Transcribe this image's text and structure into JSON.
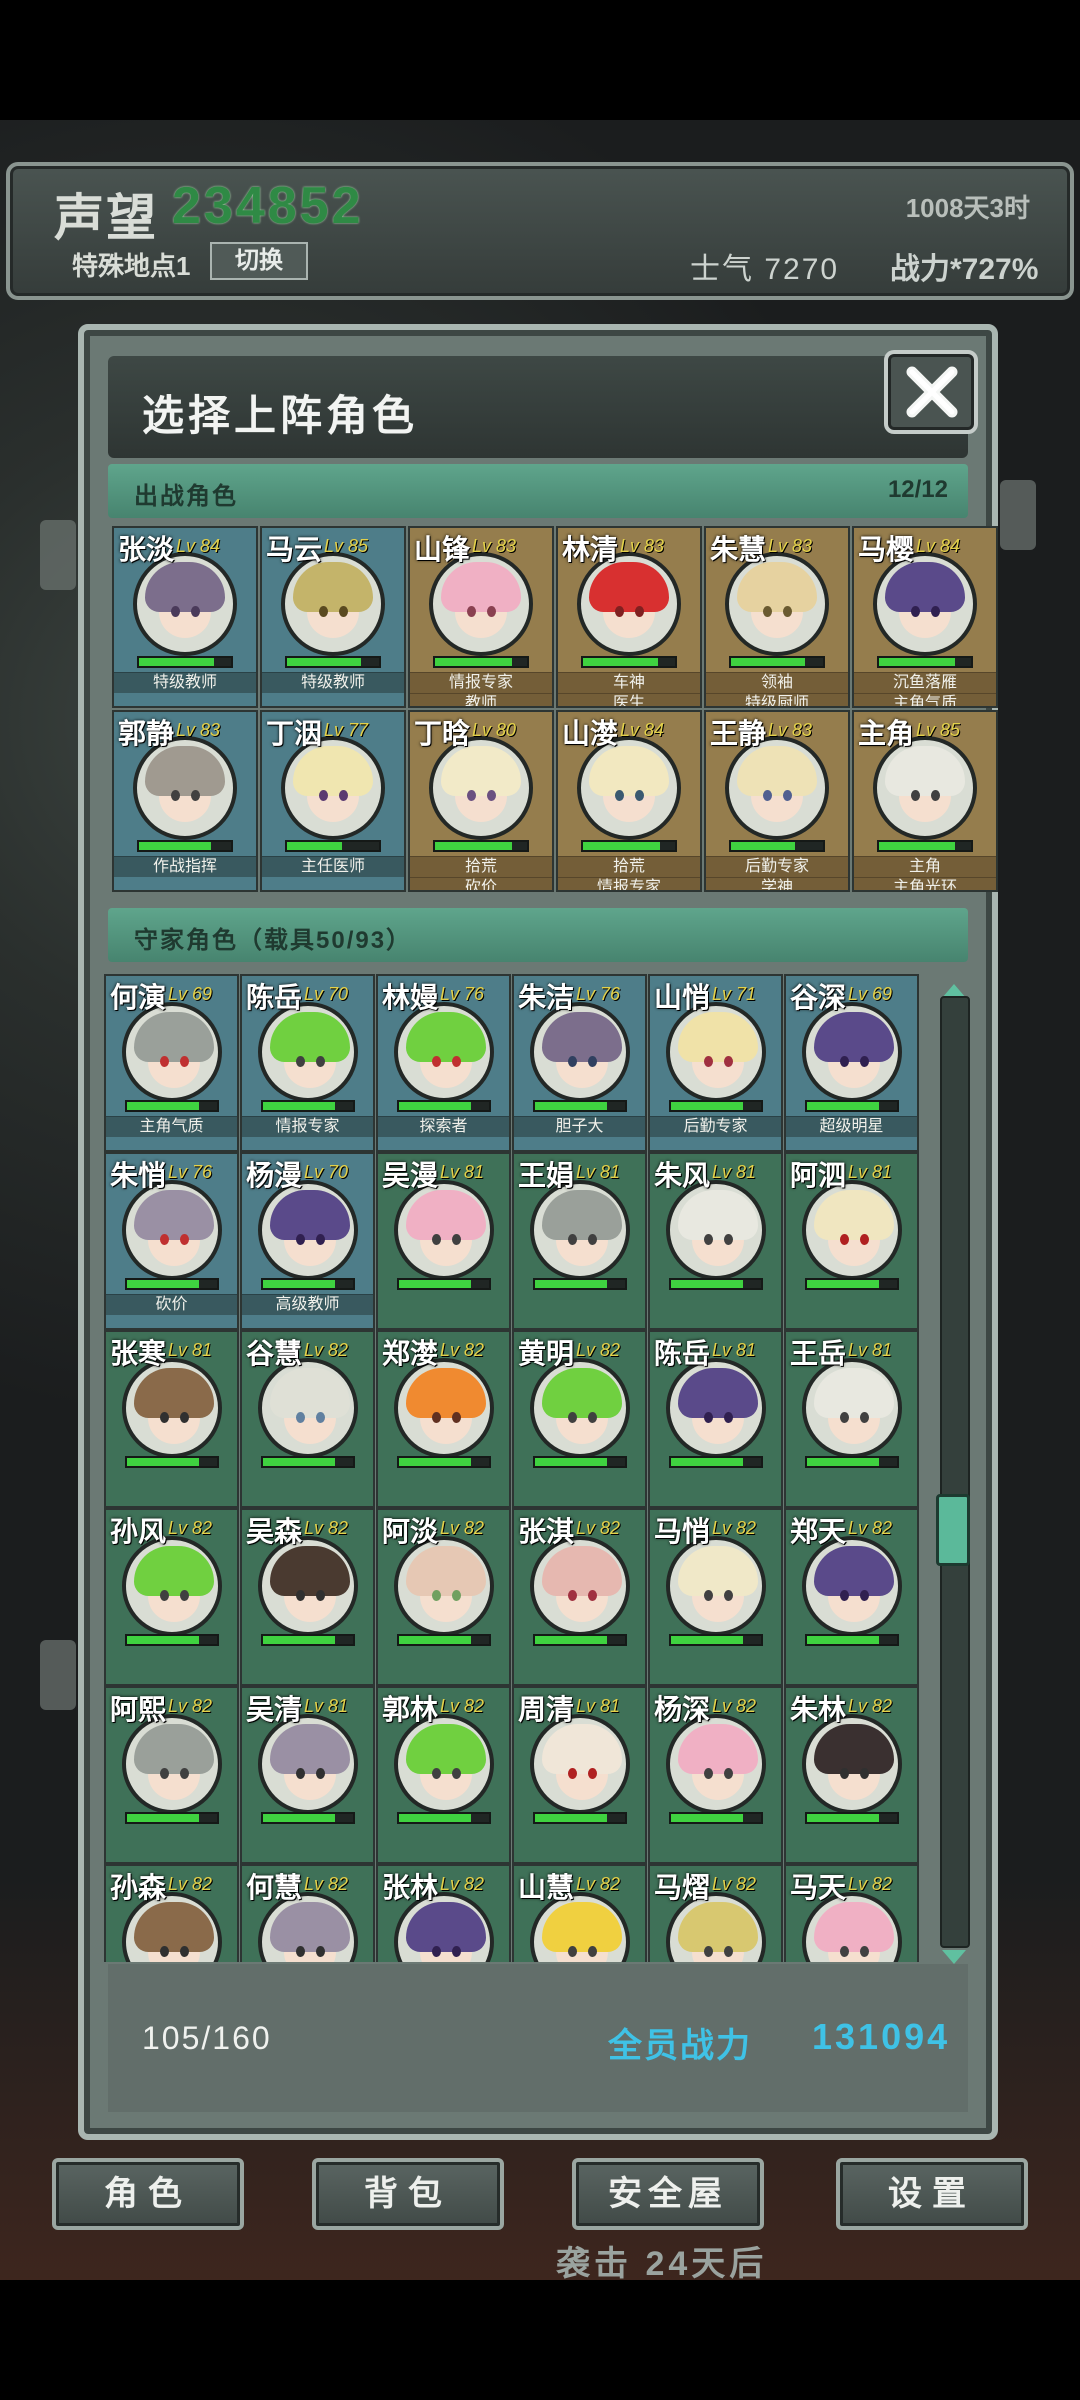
{
  "hud": {
    "reputation_label": "声望",
    "reputation_value": "234852",
    "days": "1008天3时",
    "special_location": "特殊地点1",
    "switch_label": "切换",
    "morale": "士气 7270",
    "combat_power": "战力*727%"
  },
  "modal": {
    "title": "选择上阵角色",
    "deployed_section": {
      "title": "出战角色",
      "count": "12/12"
    },
    "reserve_section": {
      "title": "守家角色（载具50/93）"
    },
    "deployed": [
      {
        "name": "张淡",
        "level": "Lv 84",
        "tags": [
          "特级教师"
        ],
        "style": "blue",
        "hair": "#7c6e8c",
        "eye": "#4a3a5a",
        "hp": 0.82
      },
      {
        "name": "马云",
        "level": "Lv 85",
        "tags": [
          "特级教师"
        ],
        "style": "blue",
        "hair": "#c4b46a",
        "eye": "#5a4a20",
        "hp": 0.8
      },
      {
        "name": "山锋",
        "level": "Lv 83",
        "tags": [
          "情报专家",
          "教师"
        ],
        "style": "gold",
        "hair": "#f0b0c4",
        "eye": "#8a4050",
        "hp": 0.84
      },
      {
        "name": "林清",
        "level": "Lv 83",
        "tags": [
          "车神",
          "医生"
        ],
        "style": "gold",
        "hair": "#d83030",
        "eye": "#802020",
        "hp": 0.82
      },
      {
        "name": "朱慧",
        "level": "Lv 83",
        "tags": [
          "领袖",
          "特级厨师"
        ],
        "style": "gold",
        "hair": "#e6d2a0",
        "eye": "#6a5a30",
        "hp": 0.8
      },
      {
        "name": "马樱",
        "level": "Lv 84",
        "tags": [
          "沉鱼落雁",
          "主角气质"
        ],
        "style": "gold",
        "hair": "#5a4a8a",
        "eye": "#302050",
        "hp": 0.83
      },
      {
        "name": "郭静",
        "level": "Lv 83",
        "tags": [
          "作战指挥"
        ],
        "style": "blue",
        "hair": "#a09a90",
        "eye": "#404040",
        "hp": 0.78
      },
      {
        "name": "丁洇",
        "level": "Lv 77",
        "tags": [
          "主任医师"
        ],
        "style": "blue",
        "hair": "#f0e6b0",
        "eye": "#5a3a70",
        "hp": 0.6
      },
      {
        "name": "丁晗",
        "level": "Lv 80",
        "tags": [
          "拾荒",
          "砍价"
        ],
        "style": "gold",
        "hair": "#f2eac8",
        "eye": "#6a5080",
        "hp": 0.84
      },
      {
        "name": "山漤",
        "level": "Lv 84",
        "tags": [
          "拾荒",
          "情报专家"
        ],
        "style": "gold",
        "hair": "#f2e8c0",
        "eye": "#3a5a70",
        "hp": 0.84
      },
      {
        "name": "王静",
        "level": "Lv 83",
        "tags": [
          "后勤专家",
          "学神"
        ],
        "style": "gold",
        "hair": "#eee2b6",
        "eye": "#506090",
        "hp": 0.7
      },
      {
        "name": "主角",
        "level": "Lv 85",
        "tags": [
          "主角",
          "主角光环"
        ],
        "style": "gold",
        "hair": "#e8e8e0",
        "eye": "#404040",
        "hp": 0.83
      }
    ],
    "reserve": [
      {
        "name": "何演",
        "level": "Lv 69",
        "tags": [
          "主角气质"
        ],
        "style": "blue",
        "hair": "#9aa09a",
        "eye": "#c03030",
        "hp": 0.8
      },
      {
        "name": "陈岳",
        "level": "Lv 70",
        "tags": [
          "情报专家"
        ],
        "style": "blue",
        "hair": "#70d040",
        "eye": "#404040",
        "hp": 0.8
      },
      {
        "name": "林嫚",
        "level": "Lv 76",
        "tags": [
          "探索者"
        ],
        "style": "blue",
        "hair": "#70d040",
        "eye": "#c03030",
        "hp": 0.8
      },
      {
        "name": "朱洁",
        "level": "Lv 76",
        "tags": [
          "胆子大"
        ],
        "style": "blue",
        "hair": "#7c6e8c",
        "eye": "#304060",
        "hp": 0.8
      },
      {
        "name": "山悄",
        "level": "Lv 71",
        "tags": [
          "后勤专家"
        ],
        "style": "blue",
        "hair": "#f0e2a8",
        "eye": "#a03040",
        "hp": 0.8
      },
      {
        "name": "谷深",
        "level": "Lv 69",
        "tags": [
          "超级明星"
        ],
        "style": "blue",
        "hair": "#5a4a8a",
        "eye": "#302050",
        "hp": 0.8
      },
      {
        "name": "朱悄",
        "level": "Lv 76",
        "tags": [
          "砍价"
        ],
        "style": "blue",
        "hair": "#9a90a4",
        "eye": "#c03030",
        "hp": 0.8
      },
      {
        "name": "杨漫",
        "level": "Lv 70",
        "tags": [
          "高级教师"
        ],
        "style": "blue",
        "hair": "#5a4a8a",
        "eye": "#302050",
        "hp": 0.8
      },
      {
        "name": "吴漫",
        "level": "Lv 81",
        "tags": [],
        "style": "green",
        "hair": "#f0b0c4",
        "eye": "#404040",
        "hp": 0.8
      },
      {
        "name": "王娟",
        "level": "Lv 81",
        "tags": [],
        "style": "green",
        "hair": "#9aa09a",
        "eye": "#404040",
        "hp": 0.8
      },
      {
        "name": "朱风",
        "level": "Lv 81",
        "tags": [],
        "style": "green",
        "hair": "#e8e8e0",
        "eye": "#404040",
        "hp": 0.8
      },
      {
        "name": "阿泗",
        "level": "Lv 81",
        "tags": [],
        "style": "green",
        "hair": "#f0e6c0",
        "eye": "#b02020",
        "hp": 0.8
      },
      {
        "name": "张寒",
        "level": "Lv 81",
        "tags": [],
        "style": "green",
        "hair": "#8a6a4a",
        "eye": "#303030",
        "hp": 0.8
      },
      {
        "name": "谷慧",
        "level": "Lv 82",
        "tags": [],
        "style": "green",
        "hair": "#dfe0d6",
        "eye": "#6080a0",
        "hp": 0.8
      },
      {
        "name": "郑漤",
        "level": "Lv 82",
        "tags": [],
        "style": "green",
        "hair": "#f08a30",
        "eye": "#603020",
        "hp": 0.8
      },
      {
        "name": "黄明",
        "level": "Lv 82",
        "tags": [],
        "style": "green",
        "hair": "#70d040",
        "eye": "#404040",
        "hp": 0.8
      },
      {
        "name": "陈岳",
        "level": "Lv 81",
        "tags": [],
        "style": "green",
        "hair": "#5a4a8a",
        "eye": "#302050",
        "hp": 0.8
      },
      {
        "name": "王岳",
        "level": "Lv 81",
        "tags": [],
        "style": "green",
        "hair": "#e8e8e0",
        "eye": "#404040",
        "hp": 0.8
      },
      {
        "name": "孙风",
        "level": "Lv 82",
        "tags": [],
        "style": "green",
        "hair": "#70d040",
        "eye": "#404040",
        "hp": 0.8
      },
      {
        "name": "吴森",
        "level": "Lv 82",
        "tags": [],
        "style": "green",
        "hair": "#4a3a30",
        "eye": "#303030",
        "hp": 0.8
      },
      {
        "name": "阿淡",
        "level": "Lv 82",
        "tags": [],
        "style": "green",
        "hair": "#e6c8b4",
        "eye": "#70a060",
        "hp": 0.8
      },
      {
        "name": "张淇",
        "level": "Lv 82",
        "tags": [],
        "style": "green",
        "hair": "#e6b8b0",
        "eye": "#a03040",
        "hp": 0.8
      },
      {
        "name": "马悄",
        "level": "Lv 82",
        "tags": [],
        "style": "green",
        "hair": "#f0e8c8",
        "eye": "#404040",
        "hp": 0.8
      },
      {
        "name": "郑天",
        "level": "Lv 82",
        "tags": [],
        "style": "green",
        "hair": "#5a4a8a",
        "eye": "#302050",
        "hp": 0.8
      },
      {
        "name": "阿熙",
        "level": "Lv 82",
        "tags": [],
        "style": "green",
        "hair": "#9aa09a",
        "eye": "#404040",
        "hp": 0.8
      },
      {
        "name": "吴清",
        "level": "Lv 81",
        "tags": [],
        "style": "green",
        "hair": "#9a90a4",
        "eye": "#303030",
        "hp": 0.8
      },
      {
        "name": "郭林",
        "level": "Lv 82",
        "tags": [],
        "style": "green",
        "hair": "#70d040",
        "eye": "#404040",
        "hp": 0.8
      },
      {
        "name": "周清",
        "level": "Lv 81",
        "tags": [],
        "style": "green",
        "hair": "#f0e6d8",
        "eye": "#b02020",
        "hp": 0.8
      },
      {
        "name": "杨深",
        "level": "Lv 82",
        "tags": [],
        "style": "green",
        "hair": "#f0b0c4",
        "eye": "#404040",
        "hp": 0.8
      },
      {
        "name": "朱林",
        "level": "Lv 82",
        "tags": [],
        "style": "green",
        "hair": "#3a3030",
        "eye": "#303030",
        "hp": 0.8
      },
      {
        "name": "孙森",
        "level": "Lv 82",
        "tags": [],
        "style": "green",
        "hair": "#8a6a4a",
        "eye": "#303030",
        "hp": 0.8
      },
      {
        "name": "何慧",
        "level": "Lv 82",
        "tags": [],
        "style": "green",
        "hair": "#9a90a4",
        "eye": "#303030",
        "hp": 0.8
      },
      {
        "name": "张林",
        "level": "Lv 82",
        "tags": [],
        "style": "green",
        "hair": "#5a4a8a",
        "eye": "#302050",
        "hp": 0.8
      },
      {
        "name": "山慧",
        "level": "Lv 82",
        "tags": [],
        "style": "green",
        "hair": "#f0d040",
        "eye": "#404040",
        "hp": 0.8
      },
      {
        "name": "马熠",
        "level": "Lv 82",
        "tags": [],
        "style": "green",
        "hair": "#d8c870",
        "eye": "#404040",
        "hp": 0.8
      },
      {
        "name": "马天",
        "level": "Lv 82",
        "tags": [],
        "style": "green",
        "hair": "#f0b0c4",
        "eye": "#404040",
        "hp": 0.8
      }
    ],
    "footer": {
      "count": "105/160",
      "total_power_label": "全员战力",
      "total_power_value": "131094"
    }
  },
  "nav": {
    "character": "角色",
    "backpack": "背包",
    "safehouse": "安全屋",
    "settings": "设置"
  },
  "raid_notice": "袭击 24天后"
}
